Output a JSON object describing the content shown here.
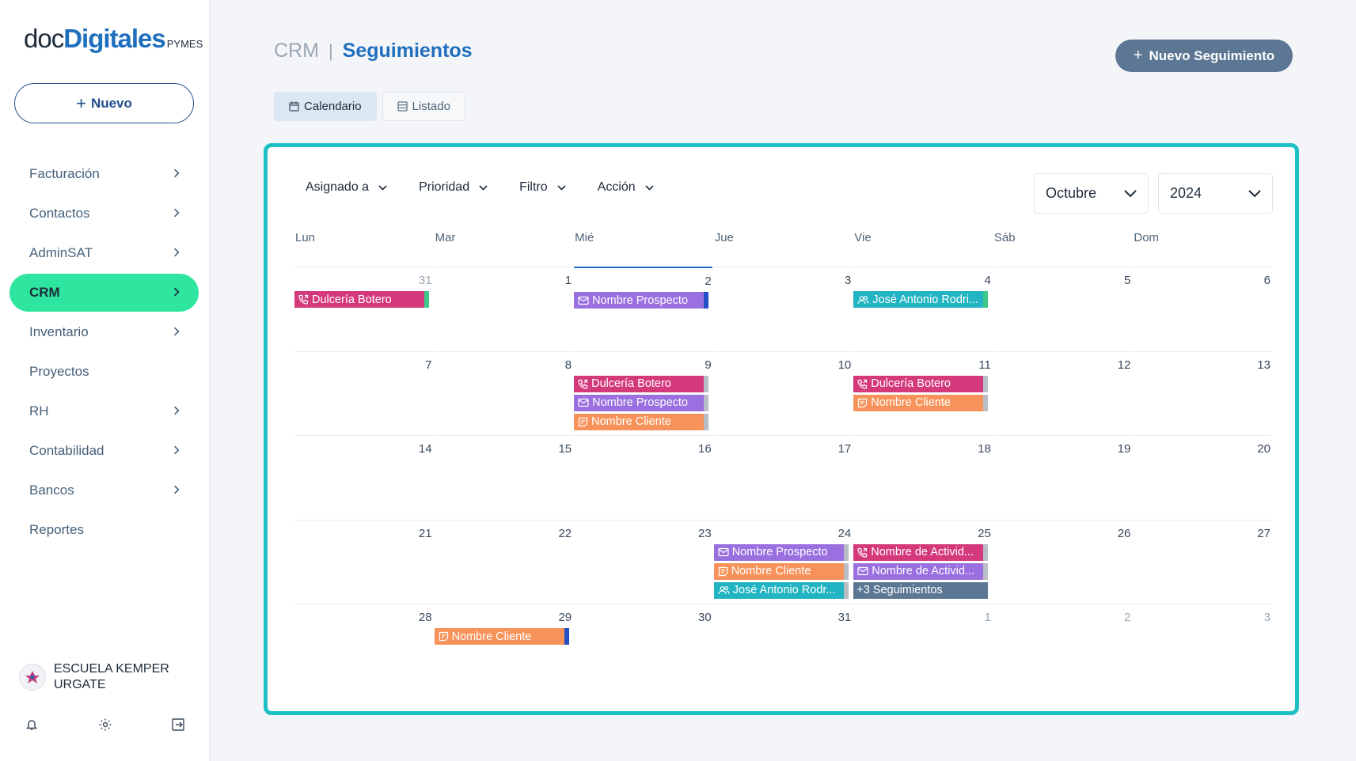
{
  "sidebar": {
    "logo": {
      "doc": "doc",
      "digitales": "Digitales",
      "pymes": "PYMES"
    },
    "new_button": "Nuevo",
    "items": [
      {
        "label": "Facturación",
        "has_chevron": true,
        "active": false
      },
      {
        "label": "Contactos",
        "has_chevron": true,
        "active": false
      },
      {
        "label": "AdminSAT",
        "has_chevron": true,
        "active": false
      },
      {
        "label": "CRM",
        "has_chevron": true,
        "active": true
      },
      {
        "label": "Inventario",
        "has_chevron": true,
        "active": false
      },
      {
        "label": "Proyectos",
        "has_chevron": false,
        "active": false
      },
      {
        "label": "RH",
        "has_chevron": true,
        "active": false
      },
      {
        "label": "Contabilidad",
        "has_chevron": true,
        "active": false
      },
      {
        "label": "Bancos",
        "has_chevron": true,
        "active": false
      },
      {
        "label": "Reportes",
        "has_chevron": false,
        "active": false
      }
    ],
    "user": {
      "name": "ESCUELA KEMPER URGATE"
    },
    "footer_icons": [
      "bell-icon",
      "gear-icon",
      "logout-icon"
    ]
  },
  "header": {
    "breadcrumb_root": "CRM",
    "separator": "|",
    "title": "Seguimientos",
    "primary_button": "Nuevo Seguimiento"
  },
  "view_tabs": [
    {
      "label": "Calendario",
      "icon": "calendar-icon",
      "active": true
    },
    {
      "label": "Listado",
      "icon": "list-icon",
      "active": false
    }
  ],
  "filters": [
    "Asignado a",
    "Prioridad",
    "Filtro",
    "Acción"
  ],
  "month_select": "Octubre",
  "year_select": "2024",
  "weekdays": [
    "Lun",
    "Mar",
    "Mié",
    "Jue",
    "Vie",
    "Sáb",
    "Dom"
  ],
  "colors": {
    "accent_green": "#2ee6a0",
    "panel_border": "#1fbfc6",
    "call": "#d4397c",
    "email": "#9a6fe0",
    "note": "#f7925a",
    "meeting": "#22b4c2",
    "more": "#5c7794"
  },
  "weeks": [
    [
      {
        "n": "31",
        "muted": true,
        "events": [
          {
            "type": "call",
            "label": "Dulcería Botero",
            "tag": "#3cc98a"
          }
        ]
      },
      {
        "n": "1",
        "events": []
      },
      {
        "n": "2",
        "today": true,
        "events": [
          {
            "type": "email",
            "label": "Nombre Prospecto",
            "tag": "#2350c8"
          }
        ]
      },
      {
        "n": "3",
        "events": []
      },
      {
        "n": "4",
        "events": [
          {
            "type": "meeting",
            "label": "José Antonio Rodri...",
            "tag": "#3cc98a"
          }
        ]
      },
      {
        "n": "5",
        "events": []
      },
      {
        "n": "6",
        "events": []
      }
    ],
    [
      {
        "n": "7",
        "events": []
      },
      {
        "n": "8",
        "events": []
      },
      {
        "n": "9",
        "events": [
          {
            "type": "call",
            "label": "Dulcería Botero",
            "tag": "#b9bec6"
          },
          {
            "type": "email",
            "label": "Nombre Prospecto",
            "tag": "#b9bec6"
          },
          {
            "type": "note",
            "label": "Nombre Cliente",
            "tag": "#b9bec6"
          }
        ]
      },
      {
        "n": "10",
        "events": []
      },
      {
        "n": "11",
        "events": [
          {
            "type": "call",
            "label": "Dulcería Botero",
            "tag": "#b9bec6"
          },
          {
            "type": "note",
            "label": "Nombre Cliente",
            "tag": "#b9bec6"
          }
        ]
      },
      {
        "n": "12",
        "events": []
      },
      {
        "n": "13",
        "events": []
      }
    ],
    [
      {
        "n": "14",
        "events": []
      },
      {
        "n": "15",
        "events": []
      },
      {
        "n": "16",
        "events": []
      },
      {
        "n": "17",
        "events": []
      },
      {
        "n": "18",
        "events": []
      },
      {
        "n": "19",
        "events": []
      },
      {
        "n": "20",
        "events": []
      }
    ],
    [
      {
        "n": "21",
        "events": []
      },
      {
        "n": "22",
        "events": []
      },
      {
        "n": "23",
        "events": []
      },
      {
        "n": "24",
        "events": [
          {
            "type": "email",
            "label": "Nombre Prospecto",
            "tag": "#b9bec6"
          },
          {
            "type": "note",
            "label": "Nombre Cliente",
            "tag": "#b9bec6"
          },
          {
            "type": "meeting",
            "label": "José Antonio Rodr...",
            "tag": "#b9bec6"
          }
        ]
      },
      {
        "n": "25",
        "events": [
          {
            "type": "call",
            "label": "Nombre de Activid...",
            "tag": "#b9bec6"
          },
          {
            "type": "email",
            "label": "Nombre de Activid...",
            "tag": "#b9bec6"
          },
          {
            "type": "more",
            "label": "+3 Seguimientos"
          }
        ]
      },
      {
        "n": "26",
        "events": []
      },
      {
        "n": "27",
        "events": []
      }
    ],
    [
      {
        "n": "28",
        "events": []
      },
      {
        "n": "29",
        "events": [
          {
            "type": "note",
            "label": "Nombre Cliente",
            "tag": "#2350c8"
          }
        ]
      },
      {
        "n": "30",
        "events": []
      },
      {
        "n": "31",
        "events": []
      },
      {
        "n": "1",
        "muted": true,
        "events": []
      },
      {
        "n": "2",
        "muted": true,
        "events": []
      },
      {
        "n": "3",
        "muted": true,
        "events": []
      }
    ]
  ]
}
